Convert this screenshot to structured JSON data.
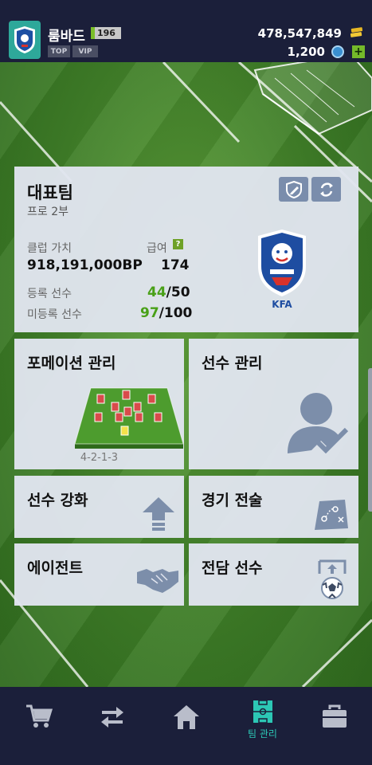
{
  "header": {
    "club_name": "룸바드",
    "level": "196",
    "tag_top": "TOP",
    "tag_vip": "VIP",
    "currency_coins": "478,547,849",
    "currency_fc": "1,200",
    "plus": "+"
  },
  "team": {
    "title": "대표팀",
    "division": "프로 2부",
    "club_value_label": "클럽 가치",
    "club_value": "918,191,000BP",
    "salary_label": "급여",
    "salary_help": "?",
    "salary_value": "174",
    "registered_label": "등록 선수",
    "registered_current": "44",
    "registered_max": "/50",
    "unregistered_label": "미등록 선수",
    "unregistered_current": "97",
    "unregistered_max": "/100",
    "emblem_text": "KFA"
  },
  "menu": {
    "formation": "포메이션 관리",
    "formation_name": "4-2-1-3",
    "players": "선수 관리",
    "upgrade": "선수 강화",
    "tactics": "경기 전술",
    "agent": "에이전트",
    "exclusive": "전담 선수"
  },
  "nav": {
    "shop": "shop",
    "transfer": "transfer",
    "home": "home",
    "team_label": "팀 관리",
    "inventory": "inventory"
  },
  "colors": {
    "topbar": "#1b1f3a",
    "accent_teal": "#2cc7b5",
    "accent_green": "#49a017",
    "icon_blue": "#7a8dac"
  }
}
